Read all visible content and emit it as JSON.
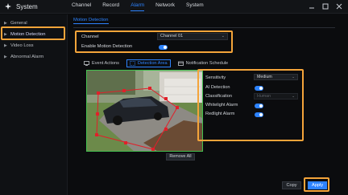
{
  "app": {
    "title": "System",
    "icon": "system-icon"
  },
  "nav": {
    "items": [
      "Channel",
      "Record",
      "Alarm",
      "Network",
      "System"
    ],
    "active": "Alarm"
  },
  "sidebar": {
    "items": [
      {
        "label": "General"
      },
      {
        "label": "Motion Detection"
      },
      {
        "label": "Video Loss"
      },
      {
        "label": "Abnormal Alarm"
      }
    ]
  },
  "subtab": {
    "label": "Motion Detection"
  },
  "form": {
    "channel_label": "Channel",
    "channel_value": "Channel 01",
    "enable_label": "Enable Motion Detection",
    "enable_on": true
  },
  "tabs2": [
    "Event Actions",
    "Detection Area",
    "Notification Schedule"
  ],
  "settings": {
    "sensitivity_label": "Sensitivity",
    "sensitivity_value": "Medium",
    "ai_label": "AI Detection",
    "classification_label": "Classification",
    "classification_value": "Human",
    "whitelight_label": "Whitelight Alarm",
    "redlight_label": "Redlight Alarm"
  },
  "buttons": {
    "remove_all": "Remove All",
    "copy": "Copy",
    "apply": "Apply"
  },
  "colors": {
    "accent": "#2d83ff",
    "highlight": "#f4a43a",
    "detection_border": "#44c050",
    "region": "#e0202a"
  }
}
